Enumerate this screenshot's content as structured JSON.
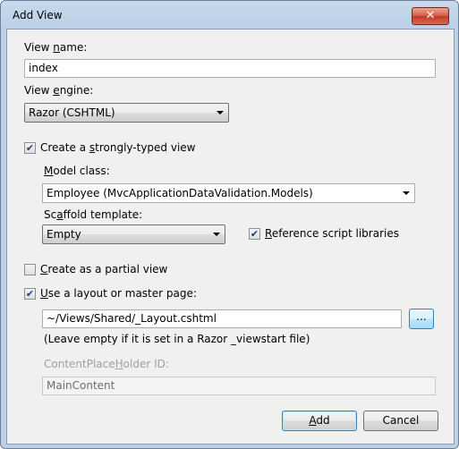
{
  "window": {
    "title": "Add View",
    "close_glyph": "✕"
  },
  "view_name": {
    "label_pre": "View ",
    "label_key": "n",
    "label_post": "ame:",
    "value": "index"
  },
  "view_engine": {
    "label_pre": "View ",
    "label_key": "e",
    "label_post": "ngine:",
    "selected": "Razor (CSHTML)"
  },
  "strongly_typed": {
    "label_pre": "Create a ",
    "label_key": "s",
    "label_post": "trongly-typed view",
    "checked": true
  },
  "model_class": {
    "label_pre": "",
    "label_key": "M",
    "label_post": "odel class:",
    "selected": "Employee (MvcApplicationDataValidation.Models)"
  },
  "scaffold": {
    "label_pre": "Sc",
    "label_key": "a",
    "label_post": "ffold template:",
    "selected": "Empty"
  },
  "reference_scripts": {
    "label_pre": "",
    "label_key": "R",
    "label_post": "eference script libraries",
    "checked": true
  },
  "partial_view": {
    "label_pre": "",
    "label_key": "C",
    "label_post": "reate as a partial view",
    "checked": false
  },
  "use_layout": {
    "label_pre": "",
    "label_key": "U",
    "label_post": "se a layout or master page:",
    "checked": true
  },
  "layout_path": {
    "value": "~/Views/Shared/_Layout.cshtml",
    "browse_label": "...",
    "hint": "(Leave empty if it is set in a Razor _viewstart file)"
  },
  "placeholder_id": {
    "label_pre": "ContentPlace",
    "label_key": "H",
    "label_post": "older ID:",
    "value": "MainContent"
  },
  "buttons": {
    "add_key": "A",
    "add_post": "dd",
    "cancel": "Cancel"
  },
  "check_glyph": "✔"
}
